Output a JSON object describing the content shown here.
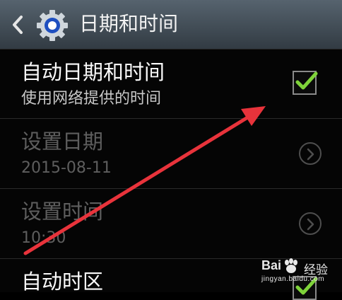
{
  "header": {
    "title": "日期和时间",
    "back_icon": "chevron-left-icon",
    "settings_icon": "gear-icon"
  },
  "settings": [
    {
      "title": "自动日期和时间",
      "subtitle": "使用网络提供的时间",
      "control": "checkbox",
      "checked": true,
      "enabled": true
    },
    {
      "title": "设置日期",
      "subtitle": "2015-08-11",
      "control": "chevron-right-icon",
      "enabled": false
    },
    {
      "title": "设置时间",
      "subtitle": "10:30",
      "control": "chevron-right-icon",
      "enabled": false
    },
    {
      "title": "自动时区",
      "control": "checkbox",
      "checked": true,
      "enabled": true
    }
  ],
  "colors": {
    "check": "#7fd33a",
    "annotation_arrow": "#e8333b",
    "appbar_top": "#56636e",
    "appbar_bottom": "#323b43"
  },
  "watermark": {
    "brand": "Bai",
    "suffix": "经验",
    "url": "jingyan.baidu.com"
  }
}
